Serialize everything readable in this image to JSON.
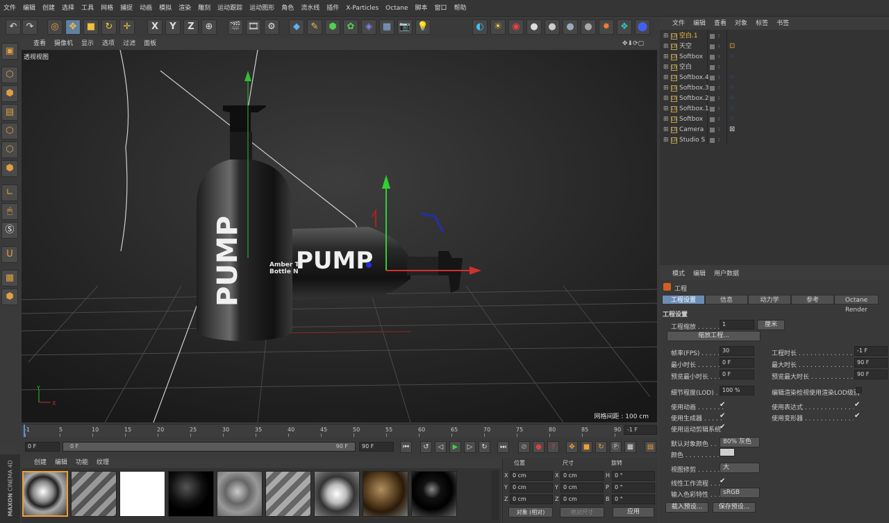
{
  "menu": [
    "文件",
    "编辑",
    "创建",
    "选择",
    "工具",
    "网格",
    "捕捉",
    "动画",
    "模拟",
    "渲染",
    "雕刻",
    "运动跟踪",
    "运动图形",
    "角色",
    "流水线",
    "插件",
    "X-Particles",
    "Octane",
    "脚本",
    "窗口",
    "帮助"
  ],
  "toolbar": {
    "axis_x": "X",
    "axis_y": "Y",
    "axis_z": "Z"
  },
  "viewport": {
    "menu": [
      "查看",
      "摄像机",
      "显示",
      "选项",
      "过滤",
      "面板"
    ],
    "label": "透视视图",
    "grid_info": "网格间距 : 100 cm",
    "scene_text": {
      "pump": "PUMP",
      "amber": "Amber Tr",
      "bottle": "Bottle N"
    }
  },
  "om": {
    "menu": [
      "文件",
      "编辑",
      "查看",
      "对象",
      "标签",
      "书签"
    ],
    "objects": [
      {
        "name": "空白.1",
        "hl": true
      },
      {
        "name": "天空"
      },
      {
        "name": "Softbox"
      },
      {
        "name": "空白"
      },
      {
        "name": "Softbox.4"
      },
      {
        "name": "Softbox.3"
      },
      {
        "name": "Softbox.2"
      },
      {
        "name": "Softbox.1"
      },
      {
        "name": "Softbox"
      },
      {
        "name": "Camera"
      },
      {
        "name": "Studio S"
      }
    ]
  },
  "attr": {
    "menu": [
      "模式",
      "编辑",
      "用户数据"
    ],
    "title": "工程",
    "tabs": [
      "工程设置",
      "信息",
      "动力学",
      "参考",
      "Octane Render"
    ],
    "section": "工程设置",
    "scale_label": "工程缩放 . . . . . .",
    "scale_value": "1",
    "scale_unit": "厘米",
    "scale_button": "缩放工程...",
    "fps_label": "帧率(FPS) . . . . .",
    "fps": "30",
    "duration_label": "工程时长 . . . . . . . . . . . . . . . . . .",
    "duration": "-1 F",
    "min_label": "最小时长 . . . . . .",
    "min": "0 F",
    "max_label": "最大时长 . . . . . . . . . . . . . . . . . .",
    "max": "90 F",
    "pmin_label": "预览最小时长 . . .",
    "pmin": "0 F",
    "pmax_label": "预览最大时长 . . . . . . . . . . . . . . . . .",
    "pmax": "90 F",
    "lod_label": "细节程度(LOD) . .",
    "lod": "100 %",
    "lod_render_label": "编辑渲染检视使用渲染LOD级别",
    "anim_label": "使用动画 . . . . . . .",
    "expr_label": "使用表达式 . . . . . . . . . . . . . . . .",
    "gen_label": "使用生成器 . . . . .",
    "deform_label": "使用变形器 . . . . . . . . . . . . . . . .",
    "motion_label": "使用运动剪辑系统",
    "color_label": "默认对象颜色 . .",
    "color_value": "80% 灰色",
    "col_label": "颜色 . . . . . . . . .",
    "clip_label": "视图修剪 . . . . . .",
    "clip_value": "大",
    "linear_label": "线性工作流程 . . .",
    "input_label": "输入色彩特性 . . .",
    "input_value": "sRGB",
    "load_btn": "载入预设...",
    "save_btn": "保存预设..."
  },
  "timeline": {
    "ticks": [
      "-1",
      "5",
      "10",
      "15",
      "20",
      "25",
      "30",
      "35",
      "40",
      "45",
      "50",
      "55",
      "60",
      "65",
      "70",
      "75",
      "80",
      "85",
      "90"
    ],
    "end_frame": "-1 F",
    "cur": "0 F",
    "slider_start": "0 F",
    "slider_end": "90 F",
    "max": "90 F"
  },
  "materials": {
    "menu": [
      "创建",
      "编辑",
      "功能",
      "纹理"
    ],
    "brand": "MAXON",
    "product": "CINEMA 4D"
  },
  "coords": {
    "headers": [
      "位置",
      "尺寸",
      "旋转"
    ],
    "x": "0 cm",
    "y": "0 cm",
    "z": "0 cm",
    "sx": "0 cm",
    "sy": "0 cm",
    "sz": "0 cm",
    "h": "0 °",
    "p": "0 °",
    "b": "0 °",
    "lx": "X",
    "ly": "Y",
    "lz": "Z",
    "lh": "H",
    "lp": "P",
    "lb": "B",
    "mode": "对象 (相对)",
    "size_mode": "绝对尺寸",
    "apply": "应用"
  }
}
